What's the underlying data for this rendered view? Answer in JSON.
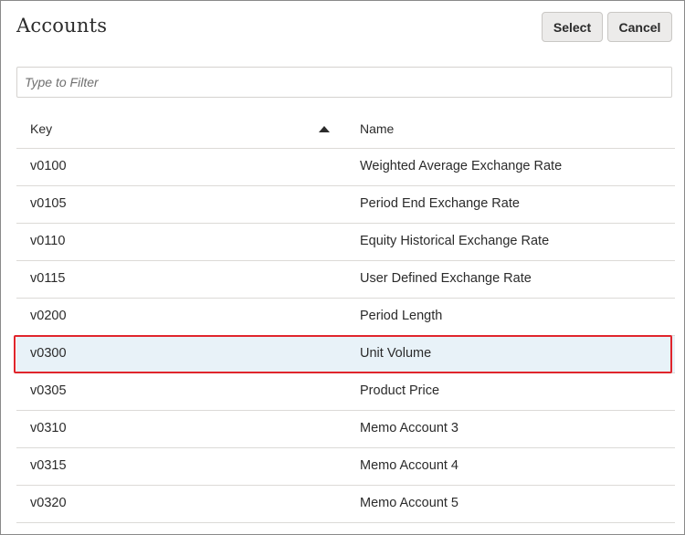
{
  "dialog": {
    "title": "Accounts",
    "select_label": "Select",
    "cancel_label": "Cancel"
  },
  "filter": {
    "placeholder": "Type to Filter",
    "value": ""
  },
  "table": {
    "columns": {
      "key": "Key",
      "name": "Name",
      "sort_column": "key",
      "sort_direction": "ascending"
    },
    "rows": [
      {
        "key": "v0100",
        "name": "Weighted Average Exchange Rate",
        "selected": false
      },
      {
        "key": "v0105",
        "name": "Period End Exchange Rate",
        "selected": false
      },
      {
        "key": "v0110",
        "name": "Equity Historical Exchange Rate",
        "selected": false
      },
      {
        "key": "v0115",
        "name": "User Defined Exchange Rate",
        "selected": false
      },
      {
        "key": "v0200",
        "name": "Period Length",
        "selected": false
      },
      {
        "key": "v0300",
        "name": "Unit Volume",
        "selected": true
      },
      {
        "key": "v0305",
        "name": "Product Price",
        "selected": false
      },
      {
        "key": "v0310",
        "name": "Memo Account 3",
        "selected": false
      },
      {
        "key": "v0315",
        "name": "Memo Account 4",
        "selected": false
      },
      {
        "key": "v0320",
        "name": "Memo Account 5",
        "selected": false
      }
    ]
  },
  "colors": {
    "selected_row_bg": "#e8f2f8",
    "highlight_border": "#e0252c",
    "button_bg": "#ecebea"
  }
}
